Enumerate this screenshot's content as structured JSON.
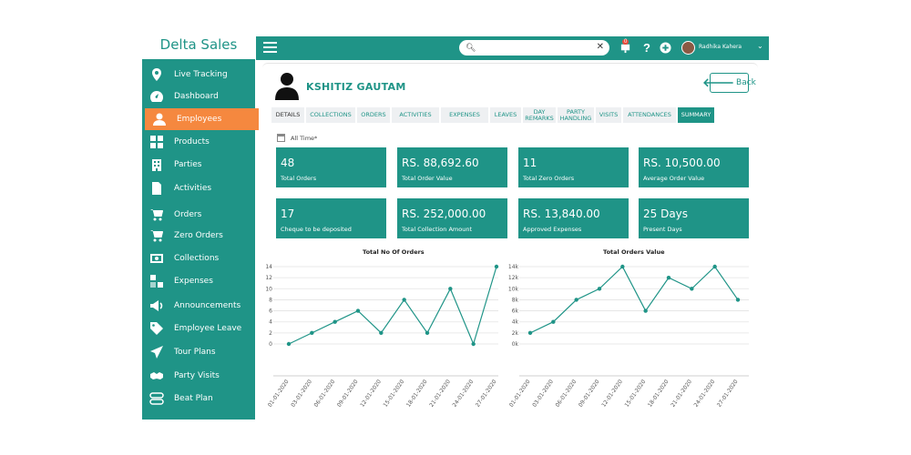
{
  "brand": "Delta Sales",
  "sidebar": {
    "items": [
      {
        "label": "Live Tracking",
        "icon": "location-pin-icon"
      },
      {
        "label": "Dashboard",
        "icon": "dashboard-gauge-icon"
      },
      {
        "label": "Employees",
        "icon": "person-icon",
        "active": true
      },
      {
        "label": "Products",
        "icon": "grid-icon"
      },
      {
        "label": "Parties",
        "icon": "building-icon"
      },
      {
        "label": "Activities",
        "icon": "document-icon"
      },
      {
        "label": "Orders",
        "icon": "cart-icon"
      },
      {
        "label": "Zero Orders",
        "icon": "cart-icon"
      },
      {
        "label": "Collections",
        "icon": "money-icon"
      },
      {
        "label": "Expenses",
        "icon": "expense-icon"
      },
      {
        "label": "Announcements",
        "icon": "megaphone-icon"
      },
      {
        "label": "Employee Leave",
        "icon": "tag-icon"
      },
      {
        "label": "Tour Plans",
        "icon": "send-icon"
      },
      {
        "label": "Party Visits",
        "icon": "handshake-icon"
      },
      {
        "label": "Beat Plan",
        "icon": "beat-plan-icon"
      }
    ]
  },
  "topbar": {
    "search_placeholder": "",
    "notification_count": "0",
    "user_name": "Radhika Kahera"
  },
  "employee": {
    "name": "KSHITIZ GAUTAM",
    "back_label": "Back"
  },
  "tabs": [
    {
      "label": "DETAILS"
    },
    {
      "label": "COLLECTIONS"
    },
    {
      "label": "ORDERS"
    },
    {
      "label": "ACTIVITIES"
    },
    {
      "label": "EXPENSES"
    },
    {
      "label": "LEAVES"
    },
    {
      "label": "DAY REMARKS"
    },
    {
      "label": "PARTY HANDLING"
    },
    {
      "label": "VISITS"
    },
    {
      "label": "ATTENDANCES"
    },
    {
      "label": "SUMMARY",
      "active": true
    }
  ],
  "period": "All Time*",
  "cards": [
    {
      "value": "48",
      "label": "Total Orders"
    },
    {
      "value": "RS. 88,692.60",
      "label": "Total Order Value"
    },
    {
      "value": "11",
      "label": "Total Zero Orders"
    },
    {
      "value": "RS. 10,500.00",
      "label": "Average Order Value"
    },
    {
      "value": "17",
      "label": "Cheque to be deposited"
    },
    {
      "value": "RS. 252,000.00",
      "label": "Total Collection Amount"
    },
    {
      "value": "RS. 13,840.00",
      "label": "Approved Expenses"
    },
    {
      "value": "25 Days",
      "label": "Present Days"
    }
  ],
  "chart_data": [
    {
      "type": "line",
      "title": "Total No Of Orders",
      "x": [
        "01-01-2020",
        "03-01-2020",
        "06-01-2020",
        "09-01-2020",
        "12-01-2020",
        "15-01-2020",
        "18-01-2020",
        "21-01-2020",
        "24-01-2020",
        "27-01-2020"
      ],
      "series": [
        {
          "values": [
            0,
            2,
            4,
            6,
            2,
            8,
            2,
            10,
            0,
            14
          ]
        }
      ],
      "yticks": [
        "0",
        "2",
        "4",
        "6",
        "8",
        "10",
        "12",
        "14"
      ],
      "ylim": [
        0,
        14
      ],
      "grid": true,
      "color": "#1f9487"
    },
    {
      "type": "line",
      "title": "Total Orders Value",
      "x": [
        "01-01-2020",
        "03-01-2020",
        "06-01-2020",
        "09-01-2020",
        "12-01-2020",
        "15-01-2020",
        "18-01-2020",
        "21-01-2020",
        "24-01-2020",
        "27-01-2020"
      ],
      "series": [
        {
          "values": [
            2000,
            4000,
            8000,
            10000,
            14000,
            6000,
            12000,
            10000,
            14000,
            8000
          ]
        }
      ],
      "yticks": [
        "0k",
        "2k",
        "4k",
        "6k",
        "8k",
        "10k",
        "12k",
        "14k"
      ],
      "ylim": [
        0,
        14000
      ],
      "grid": true,
      "color": "#1f9487"
    }
  ]
}
